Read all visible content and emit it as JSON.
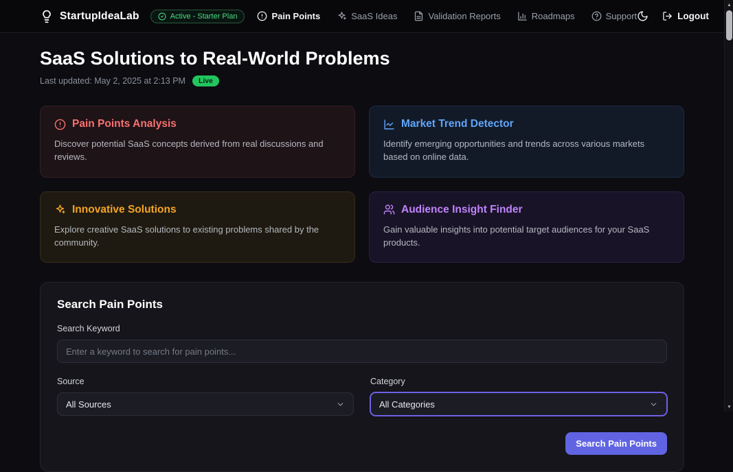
{
  "colors": {
    "accent-red": "#f87171",
    "accent-blue": "#60a5fa",
    "accent-amber": "#f5a524",
    "accent-purple": "#c084fc",
    "badge-green": "#22c55e",
    "button-indigo": "#6164e2"
  },
  "navbar": {
    "brand": "StartupIdeaLab",
    "brand_icon": "lightbulb-icon",
    "plan_badge": "Active - Starter Plan",
    "items": [
      {
        "label": "Pain Points",
        "icon": "alert-circle-icon",
        "active": true
      },
      {
        "label": "SaaS Ideas",
        "icon": "sparkles-icon",
        "active": false
      },
      {
        "label": "Validation Reports",
        "icon": "file-text-icon",
        "active": false
      },
      {
        "label": "Roadmaps",
        "icon": "bar-chart-icon",
        "active": false
      },
      {
        "label": "Support",
        "icon": "help-circle-icon",
        "active": false
      }
    ],
    "theme_icon": "moon-icon",
    "logout_label": "Logout",
    "logout_icon": "logout-icon"
  },
  "header": {
    "title": "SaaS Solutions to Real-World Problems",
    "last_updated": "Last updated: May 2, 2025 at 2:13 PM",
    "live_badge": "Live"
  },
  "cards": [
    {
      "title": "Pain Points Analysis",
      "icon": "alert-circle-icon",
      "description": "Discover potential SaaS concepts derived from real discussions and reviews."
    },
    {
      "title": "Market Trend Detector",
      "icon": "line-chart-icon",
      "description": "Identify emerging opportunities and trends across various markets based on online data."
    },
    {
      "title": "Innovative Solutions",
      "icon": "sparkles-icon",
      "description": "Explore creative SaaS solutions to existing problems shared by the community."
    },
    {
      "title": "Audience Insight Finder",
      "icon": "users-icon",
      "description": "Gain valuable insights into potential target audiences for your SaaS products."
    }
  ],
  "search": {
    "title": "Search Pain Points",
    "keyword_label": "Search Keyword",
    "keyword_placeholder": "Enter a keyword to search for pain points...",
    "source_label": "Source",
    "source_value": "All Sources",
    "category_label": "Category",
    "category_value": "All Categories",
    "button_label": "Search Pain Points"
  }
}
